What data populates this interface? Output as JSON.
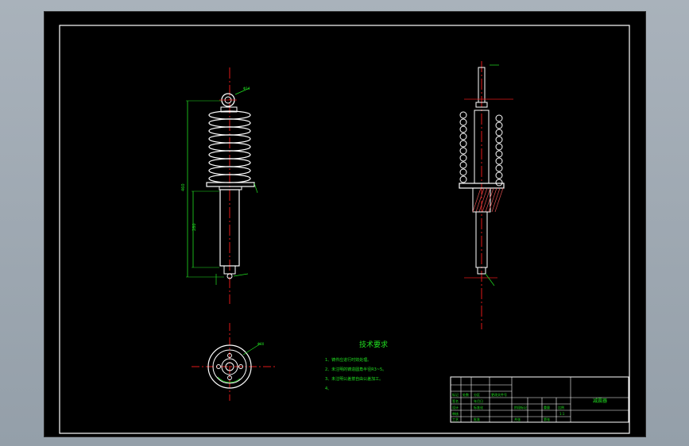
{
  "drawing": {
    "tech_requirements": {
      "title": "技术要求",
      "items": [
        "1、铸件应进行时效处理。",
        "2、未注明的铸造圆角半径R3~5。",
        "3、未注明公差按自由公差加工。",
        "4、"
      ]
    },
    "title_block": {
      "part_name": "减震器",
      "cells": [
        "标记",
        "处数",
        "分区",
        "更改文件号",
        "签名",
        "年月日",
        "设计",
        "标准化",
        "阶段标记",
        "重量",
        "比例",
        "审核",
        "工艺",
        "批准",
        "共张",
        "第张",
        "1:1"
      ]
    },
    "dimensions": {
      "total_height": "460",
      "lower_length": "280",
      "eye_dia": "Φ14",
      "base_dia": "Φ80"
    }
  },
  "colors": {
    "background": "#000000",
    "frame": "#ffffff",
    "outline": "#ffffff",
    "dimension": "#21e021",
    "centerline": "#e01818",
    "section": "#e05050"
  }
}
